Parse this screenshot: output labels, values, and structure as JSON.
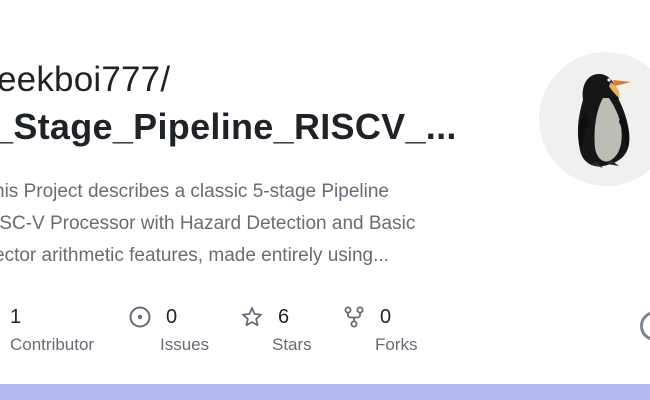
{
  "repo": {
    "owner": "eekboi777/",
    "name": "_Stage_Pipeline_RISCV_...",
    "description_lines": [
      "his Project describes a classic 5-stage Pipeline",
      "ISC-V Processor with Hazard Detection and Basic",
      "ector arithmetic features, made entirely using..."
    ]
  },
  "avatar": {
    "icon": "penguin-icon"
  },
  "stats": {
    "contributors": {
      "value": "1",
      "label": "Contributor",
      "icon": "people-icon"
    },
    "issues": {
      "value": "0",
      "label": "Issues",
      "icon": "issue-opened-icon"
    },
    "stars": {
      "value": "6",
      "label": "Stars",
      "icon": "star-icon"
    },
    "forks": {
      "value": "0",
      "label": "Forks",
      "icon": "repo-forked-icon"
    }
  },
  "colors": {
    "bottom_bar": "#b4b7f0",
    "text_primary": "#1f2328",
    "text_secondary": "#656d76"
  }
}
